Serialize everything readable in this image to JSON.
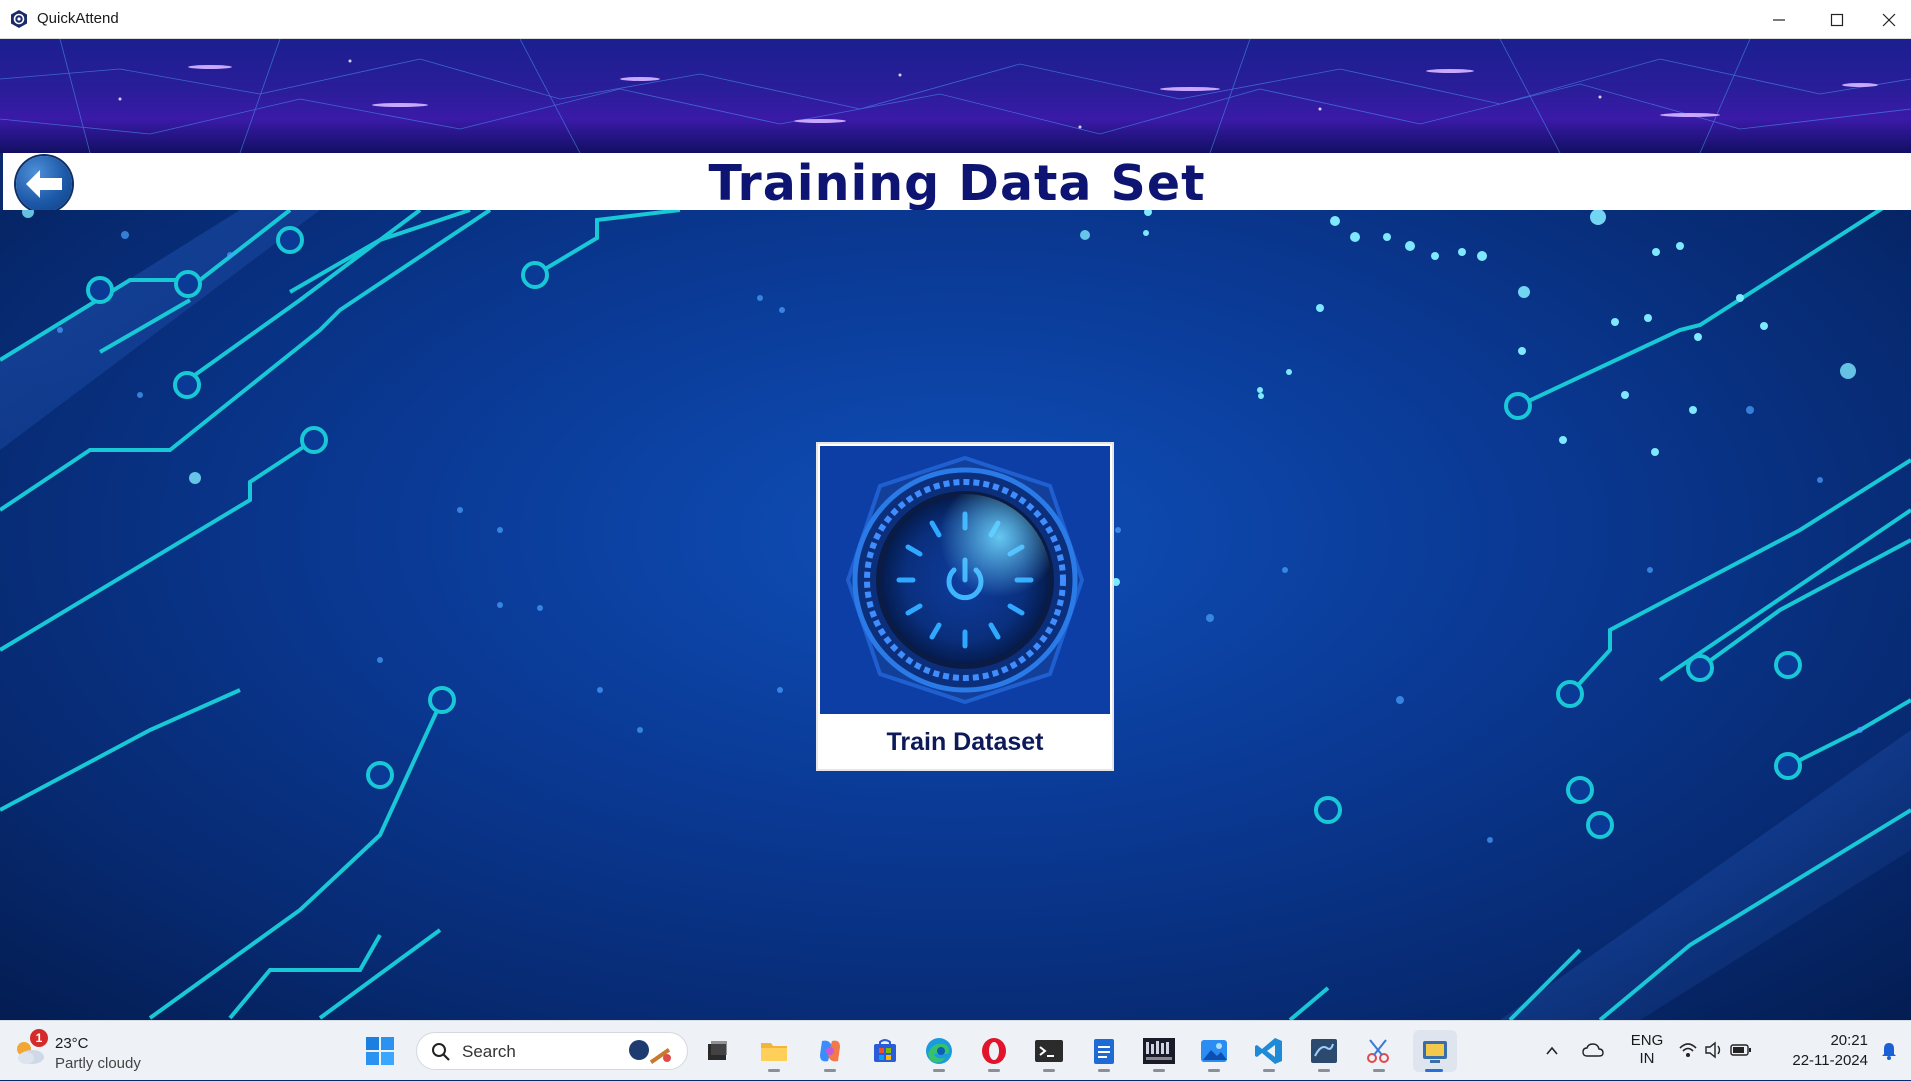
{
  "window": {
    "title": "QuickAttend",
    "app_icon": "hexagon-logo-icon",
    "controls": [
      "minimize-icon",
      "maximize-icon",
      "close-icon"
    ]
  },
  "header": {
    "title": "Training Data Set",
    "back_icon": "arrow-left-icon"
  },
  "main": {
    "train_card": {
      "image": "power-button-icon",
      "label": "Train Dataset"
    }
  },
  "taskbar": {
    "weather": {
      "badge": "1",
      "temperature": "23°C",
      "condition": "Partly cloudy",
      "icon": "partly-cloudy-icon"
    },
    "search": {
      "placeholder": "Search"
    },
    "apps": [
      {
        "name": "start-icon"
      },
      {
        "name": "task-view-icon"
      },
      {
        "name": "file-explorer-icon"
      },
      {
        "name": "copilot-icon"
      },
      {
        "name": "microsoft-store-icon"
      },
      {
        "name": "edge-icon"
      },
      {
        "name": "opera-icon"
      },
      {
        "name": "terminal-icon"
      },
      {
        "name": "notepad-icon"
      },
      {
        "name": "media-app-icon"
      },
      {
        "name": "photos-icon"
      },
      {
        "name": "vscode-icon"
      },
      {
        "name": "mysql-workbench-icon"
      },
      {
        "name": "snipping-tool-icon"
      },
      {
        "name": "python-app-icon"
      }
    ],
    "tray": {
      "language": "ENG",
      "region": "IN",
      "time": "20:21",
      "date": "22-11-2024"
    }
  },
  "colors": {
    "title_text": "#0d1472",
    "background": "#0a3a96",
    "circuit": "#19c8d6"
  }
}
